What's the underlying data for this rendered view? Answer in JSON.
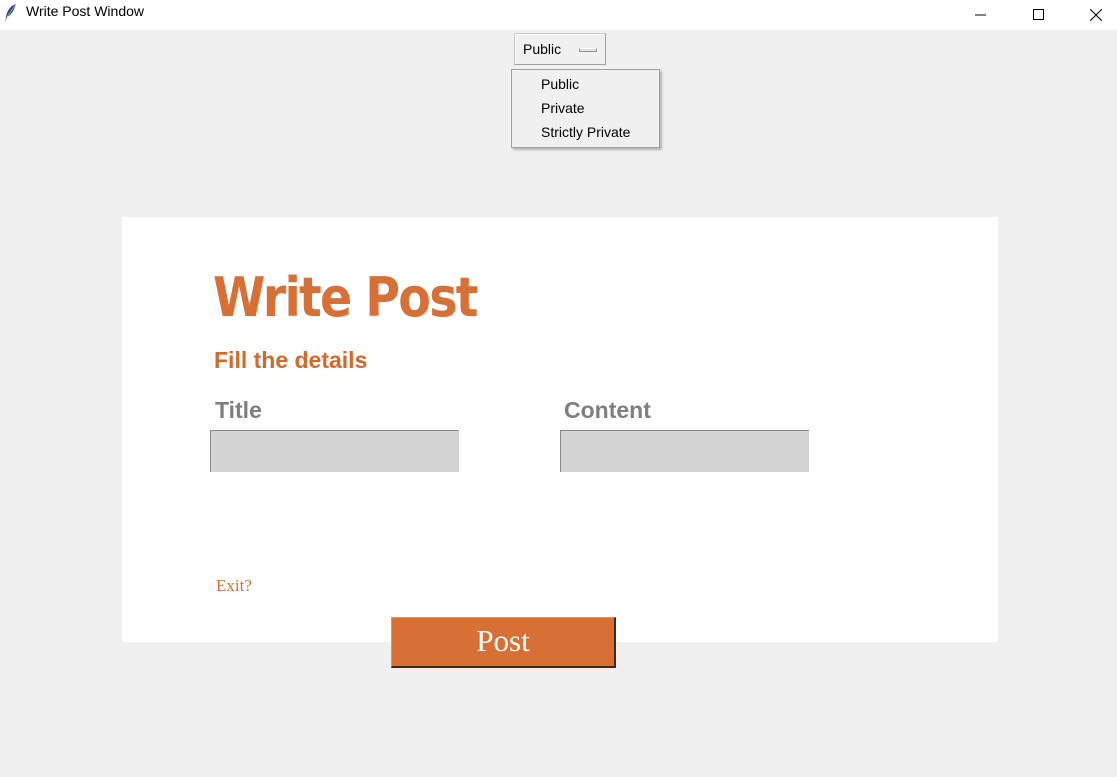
{
  "window": {
    "title": "Write Post Window",
    "icon": "feather-icon",
    "controls": [
      "minimize-icon",
      "maximize-icon",
      "close-icon"
    ]
  },
  "privacy": {
    "selected": "Public",
    "options": [
      "Public",
      "Private",
      "Strictly Private"
    ]
  },
  "form": {
    "heading": "Write Post",
    "subheading": "Fill the details",
    "title_label": "Title",
    "title_value": "",
    "content_label": "Content",
    "content_value": "",
    "exit_label": "Exit?",
    "post_label": "Post"
  },
  "colors": {
    "accent": "#d87035",
    "label_gray": "#7f7f7f",
    "field_bg": "#d3d3d3",
    "card_bg": "#ffffff",
    "window_bg": "#f0f0f0"
  }
}
